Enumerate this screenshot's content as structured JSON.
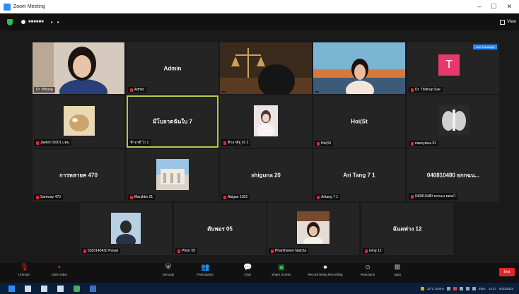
{
  "window": {
    "title": "Zoom Meeting"
  },
  "topbar": {
    "view_label": "View"
  },
  "tiles": [
    {
      "name": "",
      "label": "Dr. Whang"
    },
    {
      "name": "Admin",
      "label": "Admin"
    },
    {
      "name": "",
      "label": ""
    },
    {
      "name": "",
      "label": ""
    },
    {
      "name": "",
      "label": "Dr. Thitinup Sae",
      "avatar_letter": "T",
      "caption_button": "Live Transcript"
    },
    {
      "name": "",
      "label": "Jaekiri 01001 แพน"
    },
    {
      "name": "มีโบลาตฉันใบ 7",
      "label": "ฟ้าอาตี ไว 1"
    },
    {
      "name": "",
      "label": "ฟ้าอาตียู 01 2"
    },
    {
      "name": "Hoi(St",
      "label": "Hoi(St"
    },
    {
      "name": "",
      "label": "naeeyalua 01"
    },
    {
      "name": "การหลายค 470",
      "label": "Samway 470"
    },
    {
      "name": "",
      "label": "Manjhbn 01"
    },
    {
      "name": "shiguna 20",
      "label": "Abigan 1302"
    },
    {
      "name": "Ari Tang 7 1",
      "label": "Aritang 7 1"
    },
    {
      "name": "040810480 ยกกฉน...",
      "label": "040810480 ยกกฉน ทศณไ"
    },
    {
      "name": "",
      "label": "6320140430 Puiyat"
    },
    {
      "name": "ตับพอร 05",
      "label": "Phorr 05"
    },
    {
      "name": "",
      "label": "Phanthanen Natcha"
    },
    {
      "name": "ฉันตพ่าง 12",
      "label": "Ging 12"
    }
  ],
  "toolbar": {
    "unmute": "Unmute",
    "start_video": "Start Video",
    "security": "Security",
    "participants": "Participants",
    "participants_count": "20",
    "chat": "Chat",
    "share_screen": "Share Screen",
    "record": "Record Being Recording",
    "reactions": "Reactions",
    "apps": "Apps",
    "end": "End"
  },
  "taskbar": {
    "weather": "32°C Sunny",
    "lang": "ENG",
    "time": "14:27",
    "date": "6/10/2023"
  },
  "colors": {
    "bg": "#1a1a1a",
    "tile": "#242424",
    "active_outline": "#b6c94d",
    "end": "#e02828",
    "avatar": "#e8386e"
  }
}
